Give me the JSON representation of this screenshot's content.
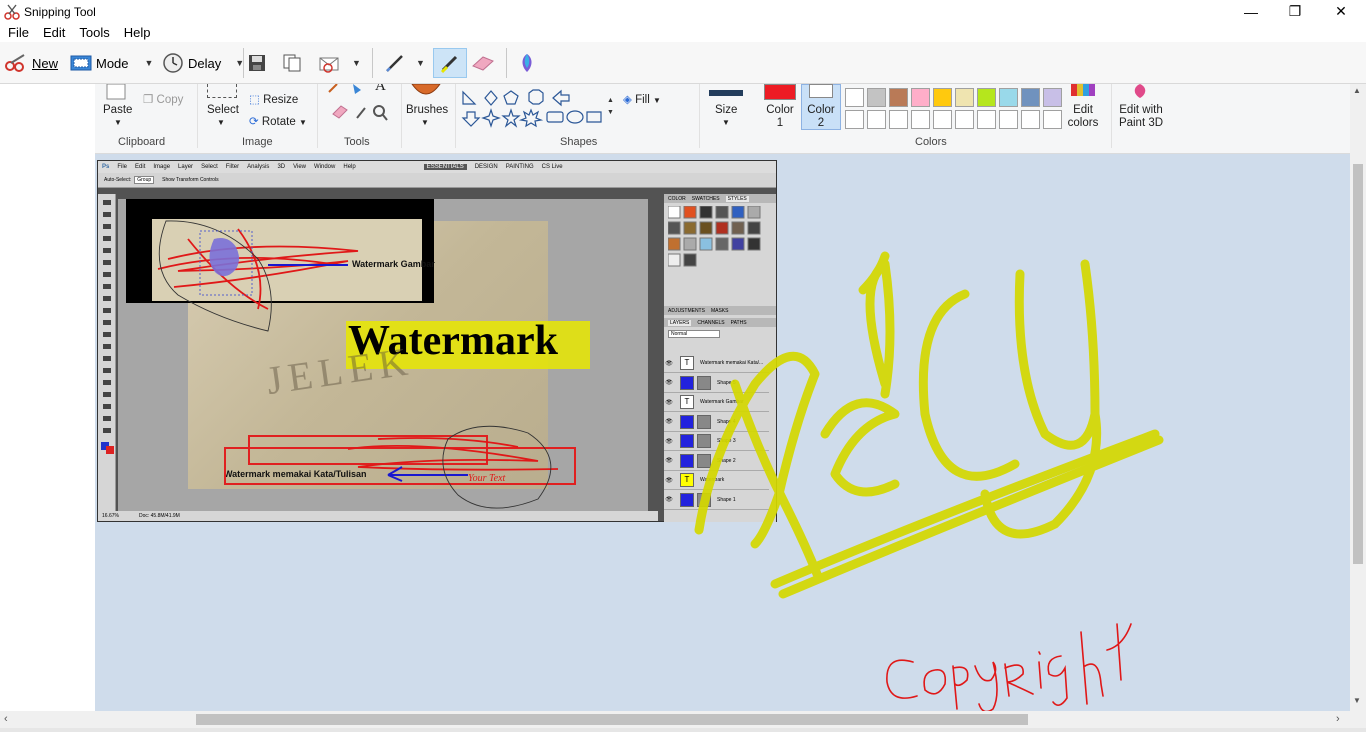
{
  "window": {
    "title": "Snipping Tool",
    "controls": {
      "minimize": "—",
      "maximize": "❐",
      "close": "✕"
    }
  },
  "menu": [
    "File",
    "Edit",
    "Tools",
    "Help"
  ],
  "toolbar": {
    "new_label": "New",
    "mode_label": "Mode",
    "delay_label": "Delay"
  },
  "ribbon": {
    "clipboard": {
      "paste": "Paste",
      "copy": "Copy",
      "group": "Clipboard"
    },
    "image": {
      "select": "Select",
      "resize": "Resize",
      "rotate": "Rotate",
      "group": "Image"
    },
    "tools": {
      "group": "Tools",
      "text_glyph": "A"
    },
    "brushes": "Brushes",
    "shapes": {
      "fill": "Fill",
      "group": "Shapes"
    },
    "size": "Size",
    "color1": {
      "line1": "Color",
      "line2": "1"
    },
    "color2": {
      "line1": "Color",
      "line2": "2"
    },
    "colors_group": "Colors",
    "edit_colors": {
      "line1": "Edit",
      "line2": "colors"
    },
    "edit_paint3d": {
      "line1": "Edit with",
      "line2": "Paint 3D"
    }
  },
  "palette": {
    "row1": [
      "#ffffff",
      "#c3c3c3",
      "#b97a57",
      "#ffaec9",
      "#ffc90e",
      "#efe4b0",
      "#b5e61d",
      "#99d9ea",
      "#7092be",
      "#c8bfe7"
    ],
    "color1": "#ed1c24",
    "color2": "#ffffff",
    "size_bar": "#233d5c"
  },
  "photoshop": {
    "menu": [
      "File",
      "Edit",
      "Image",
      "Layer",
      "Select",
      "Filter",
      "Analysis",
      "3D",
      "View",
      "Window",
      "Help"
    ],
    "workspaces": [
      "ESSENTIALS",
      "DESIGN",
      "PAINTING"
    ],
    "cs_live": "CS Live",
    "options": {
      "auto_select": "Auto-Select:",
      "group": "Group",
      "transform": "Show Transform Controls"
    },
    "panel_tabs_top": [
      "COLOR",
      "SWATCHES",
      "STYLES"
    ],
    "panel_tabs_mid": [
      "ADJUSTMENTS",
      "MASKS"
    ],
    "panel_tabs_layers": [
      "LAYERS",
      "CHANNELS",
      "PATHS"
    ],
    "blend_mode": "Normal",
    "layers": [
      {
        "name": "Watermark memakai Kata/...",
        "type": "T",
        "thumb": "#ffffff"
      },
      {
        "name": "Shape 5",
        "type": "S",
        "thumb": "#2222dd"
      },
      {
        "name": "Watermark Gambar",
        "type": "T",
        "thumb": "#ffffff"
      },
      {
        "name": "Shape 4",
        "type": "S",
        "thumb": "#2222dd"
      },
      {
        "name": "Shape 3",
        "type": "S",
        "thumb": "#2222dd"
      },
      {
        "name": "Shape 2",
        "type": "S",
        "thumb": "#2222dd"
      },
      {
        "name": "Watermark",
        "type": "T",
        "thumb": "#ffff00"
      },
      {
        "name": "Shape 1",
        "type": "S",
        "thumb": "#2222dd"
      }
    ],
    "zoom": "16.67%",
    "doc_info": "Doc: 45.8M/41.9M",
    "doc_text": {
      "watermark_big": "Watermark",
      "sand_text": "JELEK",
      "watermark_gambar": "Watermark Gambar",
      "watermark_kata": "Watermark memakai Kata/Tulisan"
    }
  },
  "annotations": {
    "big_yellow": "NEICY",
    "red_script": "CopyRight"
  }
}
